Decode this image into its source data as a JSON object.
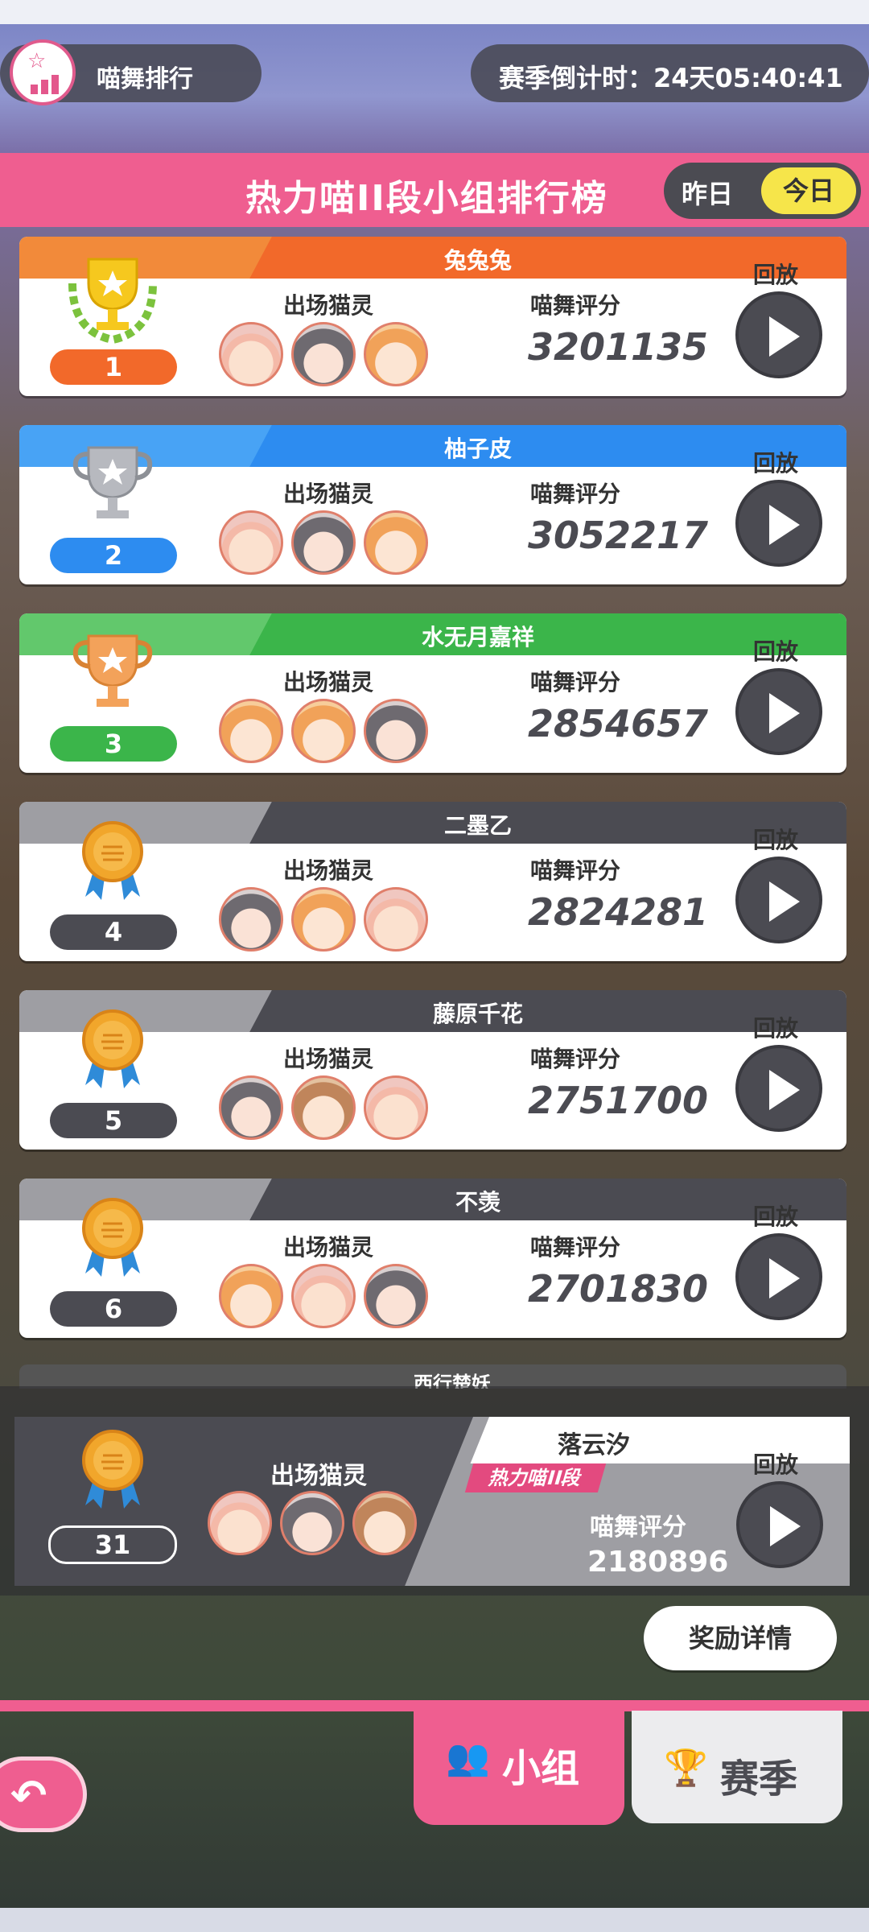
{
  "header": {
    "app_title": "喵舞排行",
    "season_countdown": "赛季倒计时：24天05:40:41",
    "board_title": "热力喵II段小组排行榜",
    "toggle_yesterday": "昨日",
    "toggle_today": "今日"
  },
  "labels": {
    "characters": "出场猫灵",
    "score": "喵舞评分",
    "replay": "回放"
  },
  "rows": [
    {
      "rank": "1",
      "name": "兔兔兔",
      "score": "3201135",
      "color": "#f2692a",
      "band_left": "#f28a3a",
      "trophy": "gold-cup-wreath"
    },
    {
      "rank": "2",
      "name": "柚子皮",
      "score": "3052217",
      "color": "#2d8cf0",
      "band_left": "#48a3f5",
      "trophy": "silver-cup"
    },
    {
      "rank": "3",
      "name": "水无月嘉祥",
      "score": "2854657",
      "color": "#3bb54a",
      "band_left": "#62c86c",
      "trophy": "bronze-cup"
    },
    {
      "rank": "4",
      "name": "二墨乙",
      "score": "2824281",
      "color": "#4b4b52",
      "band_left": "#9e9ea3",
      "trophy": "medal"
    },
    {
      "rank": "5",
      "name": "藤原千花",
      "score": "2751700",
      "color": "#4b4b52",
      "band_left": "#9e9ea3",
      "trophy": "medal"
    },
    {
      "rank": "6",
      "name": "不羡",
      "score": "2701830",
      "color": "#4b4b52",
      "band_left": "#9e9ea3",
      "trophy": "medal"
    }
  ],
  "partial_row_name": "西行楚妖",
  "my_entry": {
    "rank": "31",
    "name": "落云汐",
    "tier": "热力喵II段",
    "score": "2180896"
  },
  "reward_details": "奖励详情",
  "tabs": {
    "group": "小组",
    "season": "赛季"
  },
  "colors": {
    "accent": "#ef5e90",
    "dark": "#4b4b52",
    "toggle_active": "#f6e54a"
  }
}
